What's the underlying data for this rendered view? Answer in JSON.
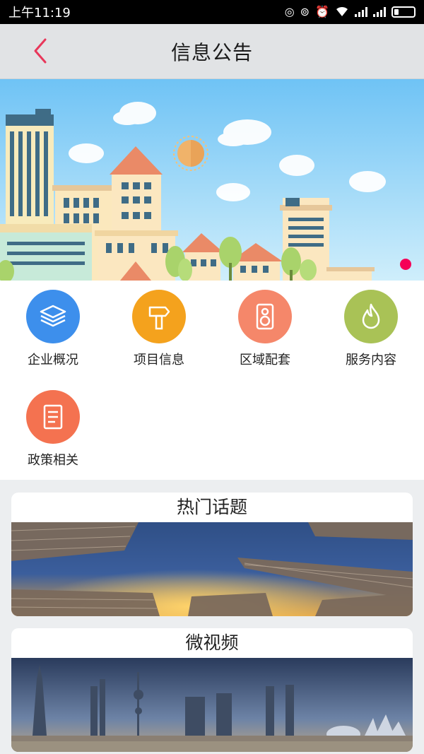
{
  "status_bar": {
    "time": "上午11:19"
  },
  "header": {
    "title": "信息公告"
  },
  "menu": {
    "items": [
      {
        "label": "企业概况",
        "icon": "layers-icon",
        "color": "#3d8fec"
      },
      {
        "label": "项目信息",
        "icon": "signpost-icon",
        "color": "#f4a21d"
      },
      {
        "label": "区域配套",
        "icon": "speaker-icon",
        "color": "#f5876a"
      },
      {
        "label": "服务内容",
        "icon": "flame-icon",
        "color": "#a9c256"
      },
      {
        "label": "政策相关",
        "icon": "document-icon",
        "color": "#f47250"
      }
    ]
  },
  "cards": [
    {
      "title": "热门话题"
    },
    {
      "title": "微视频"
    }
  ],
  "colors": {
    "accent": "#e8375a",
    "pager_dot": "#f50057"
  }
}
